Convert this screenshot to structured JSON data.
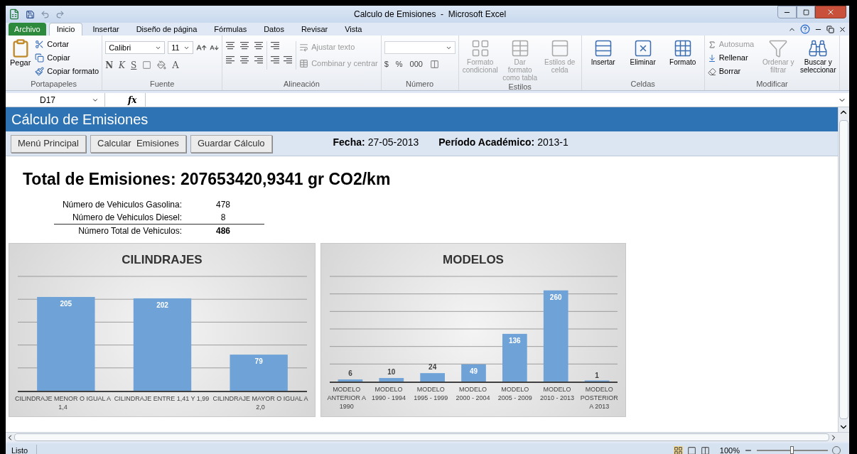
{
  "window": {
    "title": "Calculo de Emisiones  -  Microsoft Excel"
  },
  "ribbon_tabs": [
    {
      "label": "Archivo",
      "kind": "file",
      "selected": false
    },
    {
      "label": "Inicio",
      "kind": "tab",
      "selected": true
    },
    {
      "label": "Insertar",
      "kind": "tab",
      "selected": false
    },
    {
      "label": "Diseño de página",
      "kind": "tab",
      "selected": false
    },
    {
      "label": "Fórmulas",
      "kind": "tab",
      "selected": false
    },
    {
      "label": "Datos",
      "kind": "tab",
      "selected": false
    },
    {
      "label": "Revisar",
      "kind": "tab",
      "selected": false
    },
    {
      "label": "Vista",
      "kind": "tab",
      "selected": false
    }
  ],
  "ribbon_groups": [
    {
      "kind": "clipboard",
      "label": "Portapapeles",
      "items": [
        {
          "label": "Pegar"
        },
        {
          "label": "Cortar"
        },
        {
          "label": "Copiar"
        },
        {
          "label": "Copiar formato"
        }
      ]
    },
    {
      "kind": "font",
      "label": "Fuente",
      "font": "Calibri",
      "size": "11",
      "styles": [
        "N",
        "K",
        "S"
      ],
      "color_letter": "A"
    },
    {
      "kind": "alignment",
      "label": "Alineación",
      "items": [
        {
          "label": "Ajustar texto",
          "disabled": true
        },
        {
          "label": "Combinar y centrar",
          "disabled": true
        }
      ]
    },
    {
      "kind": "number",
      "label": "Número",
      "symbols": [
        "$",
        "%",
        "000"
      ]
    },
    {
      "kind": "buttons",
      "label": "Estilos",
      "items": [
        {
          "label": "Formato condicional",
          "disabled": true
        },
        {
          "label": "Dar formato como tabla",
          "disabled": true
        },
        {
          "label": "Estilos de celda",
          "disabled": true
        }
      ]
    },
    {
      "kind": "buttons",
      "label": "Celdas",
      "items": [
        {
          "label": "Insertar",
          "disabled": false
        },
        {
          "label": "Eliminar",
          "disabled": false
        },
        {
          "label": "Formato",
          "disabled": false
        }
      ]
    },
    {
      "kind": "editing",
      "label": "Modificar",
      "items": [
        {
          "label": "Autosuma",
          "disabled": true
        },
        {
          "label": "Rellenar",
          "disabled": false
        },
        {
          "label": "Borrar",
          "disabled": false
        },
        {
          "label": "Ordenar y filtrar",
          "disabled": true
        },
        {
          "label": "Buscar y seleccionar",
          "disabled": false
        }
      ]
    }
  ],
  "formula_bar": {
    "name_box": "D17",
    "function_label": "fx"
  },
  "sheet": {
    "title": "Cálculo de Emisiones",
    "buttons": [
      "Menú Principal",
      "Calcular  Emisiones",
      "Guardar Cálculo"
    ],
    "fields": [
      {
        "label": "Fecha:",
        "value": "27-05-2013"
      },
      {
        "label": "Período Académico:",
        "value": "2013-1"
      }
    ],
    "total": "Total de Emisiones: 207653420,9341 gr CO2/km",
    "counts": [
      {
        "label": "Número de Vehiculos Gasolina:",
        "value": "478",
        "kind": "row"
      },
      {
        "label": "Número de Vehiculos Diesel:",
        "value": "8",
        "kind": "row"
      },
      {
        "label": "Número Total de Vehiculos:",
        "value": "486",
        "kind": "total"
      }
    ],
    "charts": [
      {
        "chart_data": {
          "type": "bar",
          "title": "CILINDRAJES",
          "categories": [
            "CILINDRAJE MENOR O IGUAL A 1,4",
            "CILINDRAJE ENTRE 1,41 Y 1,99",
            "CILINDRAJE MAYOR O IGUAL A 2,0"
          ],
          "series": [
            {
              "color": "#6fa3d7",
              "values": [
                205,
                202,
                79
              ]
            }
          ],
          "ylim": [
            0,
            250
          ],
          "data_labels": true
        }
      },
      {
        "chart_data": {
          "type": "bar",
          "title": "MODELOS",
          "categories": [
            "MODELO ANTERIOR A 1990",
            "MODELO 1990 - 1994",
            "MODELO 1995 - 1999",
            "MODELO 2000 - 2004",
            "MODELO 2005 - 2009",
            "MODELO 2010 - 2013",
            "MODELO POSTERIOR A 2013"
          ],
          "series": [
            {
              "color": "#6fa3d7",
              "values": [
                6,
                10,
                24,
                49,
                136,
                260,
                1
              ]
            }
          ],
          "ylim": [
            0,
            300
          ],
          "data_labels": true
        }
      }
    ]
  },
  "status_bar": {
    "status": "Listo",
    "zoom": {
      "reading": "100%",
      "level": 0.5
    }
  }
}
